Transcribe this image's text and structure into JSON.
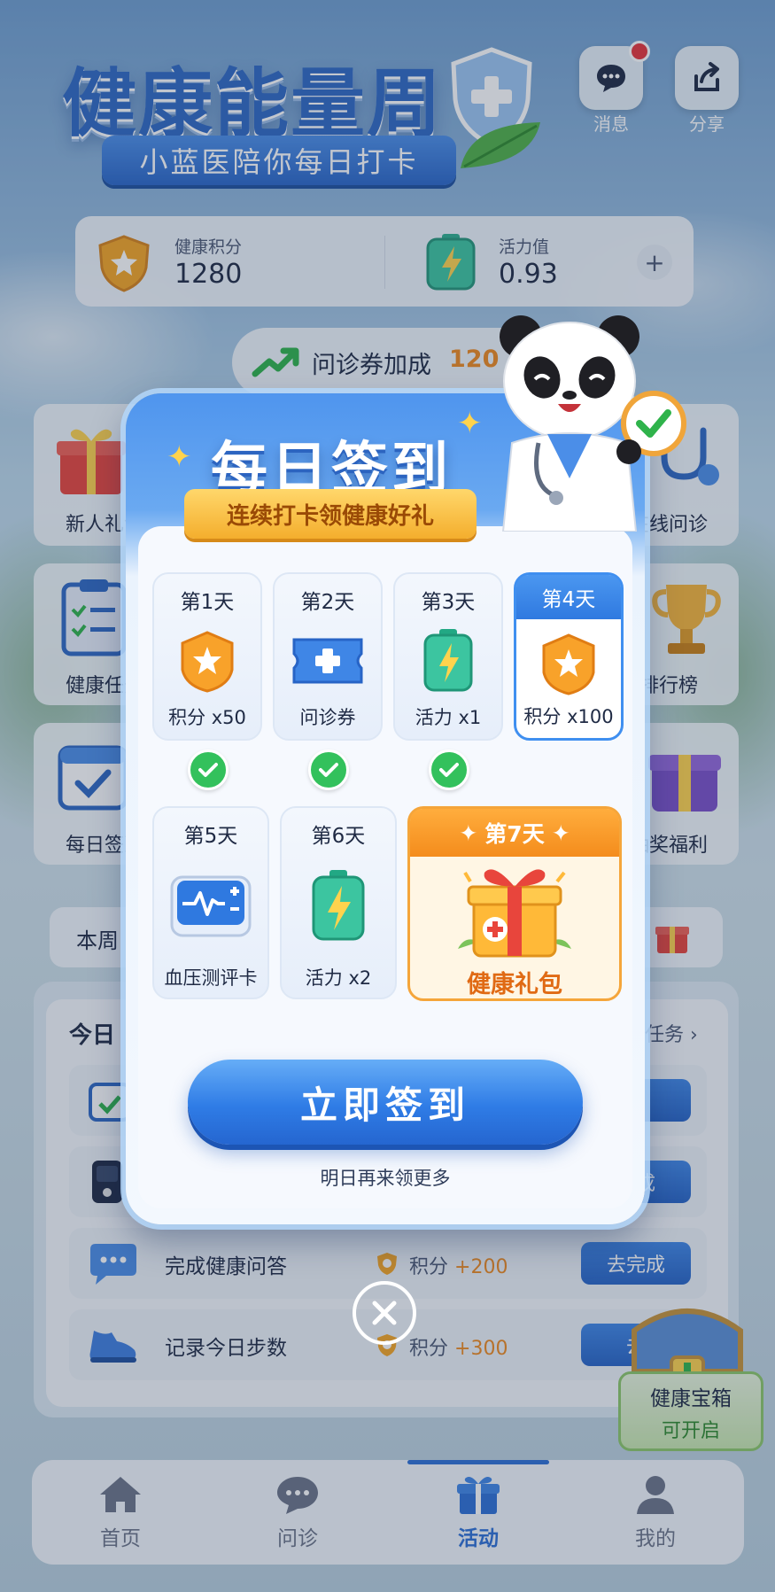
{
  "header": {
    "title": "健康能量周",
    "subtitle": "小蓝医陪你每日打卡",
    "actions": [
      {
        "label": "消息",
        "icon": "message-icon"
      },
      {
        "label": "分享",
        "icon": "share-icon"
      }
    ]
  },
  "stats": {
    "health_points_label": "健康积分",
    "health_points_value": "1280",
    "vitality_label": "活力值",
    "vitality_value": "0.93",
    "add_symbol": "+"
  },
  "boost": {
    "label": "问诊券加成",
    "value": "120"
  },
  "grid_tiles": [
    {
      "label": "新人礼包",
      "icon": "gift-icon"
    },
    {
      "label": "在线问诊",
      "icon": "stethoscope-icon"
    },
    {
      "label": "健康任务",
      "icon": "checklist-icon"
    },
    {
      "label": "排行榜",
      "icon": "trophy-icon"
    },
    {
      "label": "每日签到",
      "icon": "calendar-icon"
    },
    {
      "label": "抽奖福利",
      "icon": "lottery-box-icon"
    }
  ],
  "week_bar": {
    "label": "本周"
  },
  "tasks": {
    "title": "今日",
    "more_label": "任务",
    "rows": [
      {
        "name": "",
        "reward_label": "",
        "reward_value": "",
        "button": "成"
      },
      {
        "name": "",
        "reward_label": "",
        "reward_value": "",
        "button": "完成"
      },
      {
        "name": "完成健康问答",
        "reward_label": "积分",
        "reward_value": "+200",
        "button": "去完成"
      },
      {
        "name": "记录今日步数",
        "reward_label": "积分",
        "reward_value": "+300",
        "button": "去"
      }
    ]
  },
  "chest": {
    "title": "健康宝箱",
    "status": "可开启"
  },
  "tabbar": [
    {
      "label": "首页",
      "icon": "home-icon",
      "active": false
    },
    {
      "label": "问诊",
      "icon": "chat-icon",
      "active": false
    },
    {
      "label": "活动",
      "icon": "gift-icon",
      "active": true
    },
    {
      "label": "我的",
      "icon": "user-icon",
      "active": false
    }
  ],
  "modal": {
    "title": "每日签到",
    "ribbon": "连续打卡领健康好礼",
    "days": [
      {
        "title": "第1天",
        "reward": "积分 x50",
        "icon": "points-badge-icon",
        "claimed": true
      },
      {
        "title": "第2天",
        "reward": "问诊券",
        "icon": "consult-ticket-icon",
        "claimed": true
      },
      {
        "title": "第3天",
        "reward": "活力 x1",
        "icon": "energy-battery-icon",
        "claimed": true
      },
      {
        "title": "第4天",
        "reward": "积分 x100",
        "icon": "points-badge-icon",
        "claimed": false,
        "today": true
      },
      {
        "title": "第5天",
        "reward": "血压测评卡",
        "icon": "bp-monitor-icon",
        "claimed": false
      },
      {
        "title": "第6天",
        "reward": "活力 x2",
        "icon": "energy-battery-icon",
        "claimed": false
      },
      {
        "title": "第7天",
        "reward": "健康礼包",
        "icon": "gift-box-icon",
        "claimed": false
      }
    ],
    "signin_button": "立即签到",
    "hint": "明日再来领更多"
  },
  "colors": {
    "primary": "#2f7ce6",
    "accent_orange": "#f48c1c",
    "success": "#33c15c",
    "points": "#ef8a1f"
  }
}
